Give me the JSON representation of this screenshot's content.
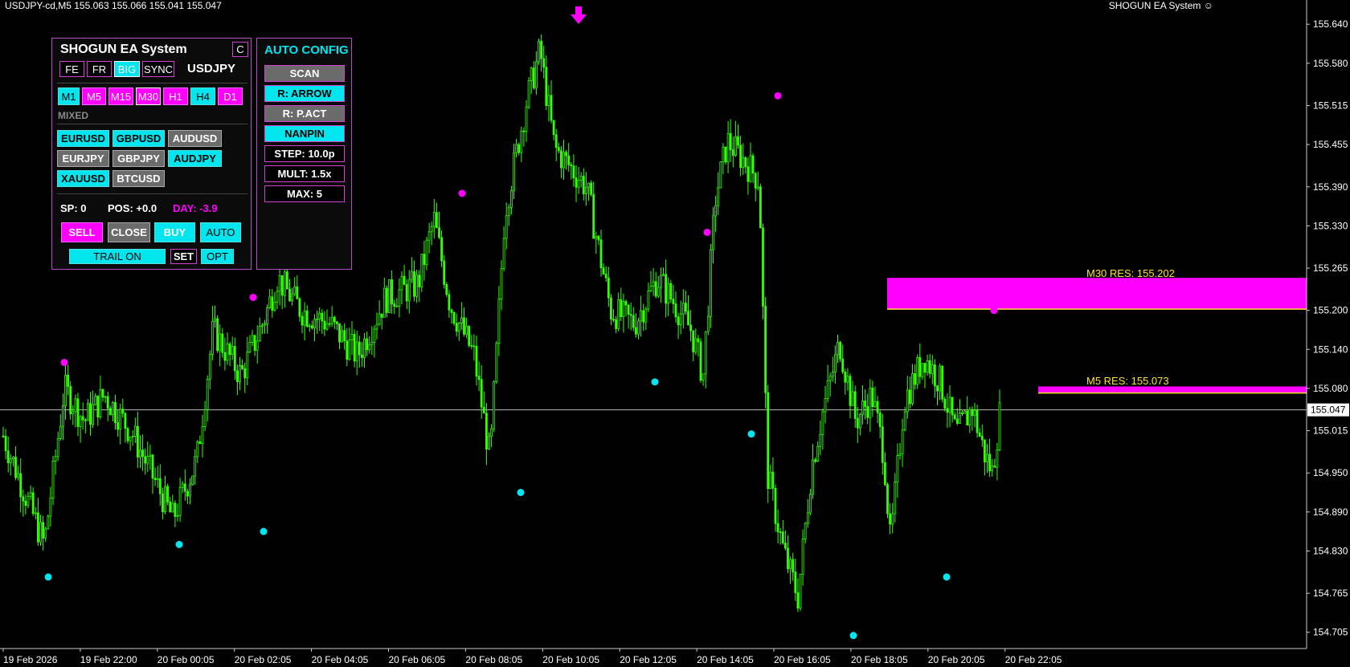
{
  "window": {
    "title_line": "USDJPY-cd,M5  155.063 155.066 155.041 155.047",
    "ea_name": "SHOGUN EA System",
    "smiley_icon": "smiley-icon"
  },
  "panel": {
    "title": "SHOGUN EA System",
    "close_label": "C",
    "toggles": [
      "FE",
      "FR",
      "BIG",
      "SYNC"
    ],
    "symbol": "USDJPY",
    "timeframes": [
      "M1",
      "M5",
      "M15",
      "M30",
      "H1",
      "H4",
      "D1"
    ],
    "mode_label": "MIXED",
    "pairs_row1": [
      "EURUSD",
      "GBPUSD",
      "AUDUSD"
    ],
    "pairs_row2": [
      "EURJPY",
      "GBPJPY",
      "AUDJPY"
    ],
    "pairs_row3": [
      "XAUUSD",
      "BTCUSD"
    ],
    "stats": {
      "sp": "SP: 0",
      "pos": "POS: +0.0",
      "day": "DAY: -3.9"
    },
    "actions": [
      "SELL",
      "CLOSE",
      "BUY",
      "AUTO"
    ],
    "trail": "TRAIL ON",
    "set": "SET",
    "opt": "OPT"
  },
  "auto_config": {
    "title": "AUTO CONFIG",
    "buttons": [
      "SCAN",
      "R: ARROW",
      "R: P.ACT",
      "NANPIN",
      "STEP: 10.0p",
      "MULT: 1.5x",
      "MAX: 5"
    ]
  },
  "levels": {
    "m30": "M30 RES: 155.202",
    "m5": "M5 RES: 155.073",
    "current_price": "155.047"
  },
  "colors": {
    "candle": "#33ff00",
    "magenta": "#ff00ff",
    "cyan": "#00e5ee",
    "level_text": "#ffe030"
  },
  "chart_data": {
    "type": "candlestick",
    "symbol": "USDJPY-cd",
    "timeframe": "M5",
    "ylim": [
      154.68,
      155.66
    ],
    "y_ticks": [
      "155.640",
      "155.580",
      "155.515",
      "155.455",
      "155.390",
      "155.330",
      "155.265",
      "155.200",
      "155.140",
      "155.080",
      "155.015",
      "154.950",
      "154.890",
      "154.830",
      "154.765",
      "154.705"
    ],
    "x_ticks": [
      "19 Feb 2026",
      "19 Feb 22:00",
      "20 Feb 00:05",
      "20 Feb 02:05",
      "20 Feb 04:05",
      "20 Feb 06:05",
      "20 Feb 08:05",
      "20 Feb 10:05",
      "20 Feb 12:05",
      "20 Feb 14:05",
      "20 Feb 16:05",
      "20 Feb 18:05",
      "20 Feb 20:05",
      "20 Feb 22:05"
    ],
    "price_path": [
      [
        0,
        155.02
      ],
      [
        55,
        154.84
      ],
      [
        80,
        155.08
      ],
      [
        105,
        155.03
      ],
      [
        130,
        155.07
      ],
      [
        165,
        155.01
      ],
      [
        215,
        154.88
      ],
      [
        245,
        154.97
      ],
      [
        265,
        155.17
      ],
      [
        300,
        155.1
      ],
      [
        330,
        155.19
      ],
      [
        345,
        155.25
      ],
      [
        375,
        155.2
      ],
      [
        410,
        155.18
      ],
      [
        445,
        155.13
      ],
      [
        480,
        155.22
      ],
      [
        520,
        155.24
      ],
      [
        540,
        155.34
      ],
      [
        560,
        155.21
      ],
      [
        590,
        155.13
      ],
      [
        610,
        154.97
      ],
      [
        628,
        155.35
      ],
      [
        655,
        155.52
      ],
      [
        672,
        155.6
      ],
      [
        690,
        155.45
      ],
      [
        730,
        155.39
      ],
      [
        760,
        155.2
      ],
      [
        790,
        155.18
      ],
      [
        818,
        155.25
      ],
      [
        840,
        155.21
      ],
      [
        860,
        155.17
      ],
      [
        875,
        155.1
      ],
      [
        890,
        155.37
      ],
      [
        905,
        155.46
      ],
      [
        920,
        155.44
      ],
      [
        945,
        155.4
      ],
      [
        955,
        154.95
      ],
      [
        975,
        154.83
      ],
      [
        993,
        154.76
      ],
      [
        1010,
        154.96
      ],
      [
        1025,
        155.05
      ],
      [
        1045,
        155.15
      ],
      [
        1065,
        155.03
      ],
      [
        1085,
        155.07
      ],
      [
        1100,
        154.98
      ],
      [
        1108,
        154.84
      ],
      [
        1125,
        155.06
      ],
      [
        1150,
        155.13
      ],
      [
        1170,
        155.09
      ],
      [
        1190,
        155.01
      ],
      [
        1210,
        155.05
      ],
      [
        1225,
        154.98
      ],
      [
        1235,
        154.95
      ],
      [
        1245,
        155.05
      ]
    ],
    "signal_dots_magenta": [
      [
        80,
        155.12
      ],
      [
        315,
        155.22
      ],
      [
        575,
        155.38
      ],
      [
        880,
        155.32
      ],
      [
        968,
        155.53
      ],
      [
        1237,
        155.2
      ]
    ],
    "signal_dots_cyan": [
      [
        60,
        154.79
      ],
      [
        223,
        154.84
      ],
      [
        328,
        154.86
      ],
      [
        648,
        154.92
      ],
      [
        815,
        155.09
      ],
      [
        935,
        155.01
      ],
      [
        1062,
        154.7
      ],
      [
        1178,
        154.79
      ]
    ],
    "sell_arrow_x": 720,
    "resistance_zones": [
      {
        "label": "M30 RES: 155.202",
        "top": 155.25,
        "bottom": 155.202
      },
      {
        "label": "M5 RES: 155.073",
        "top": 155.083,
        "bottom": 155.073
      }
    ],
    "current_price": 155.047
  }
}
